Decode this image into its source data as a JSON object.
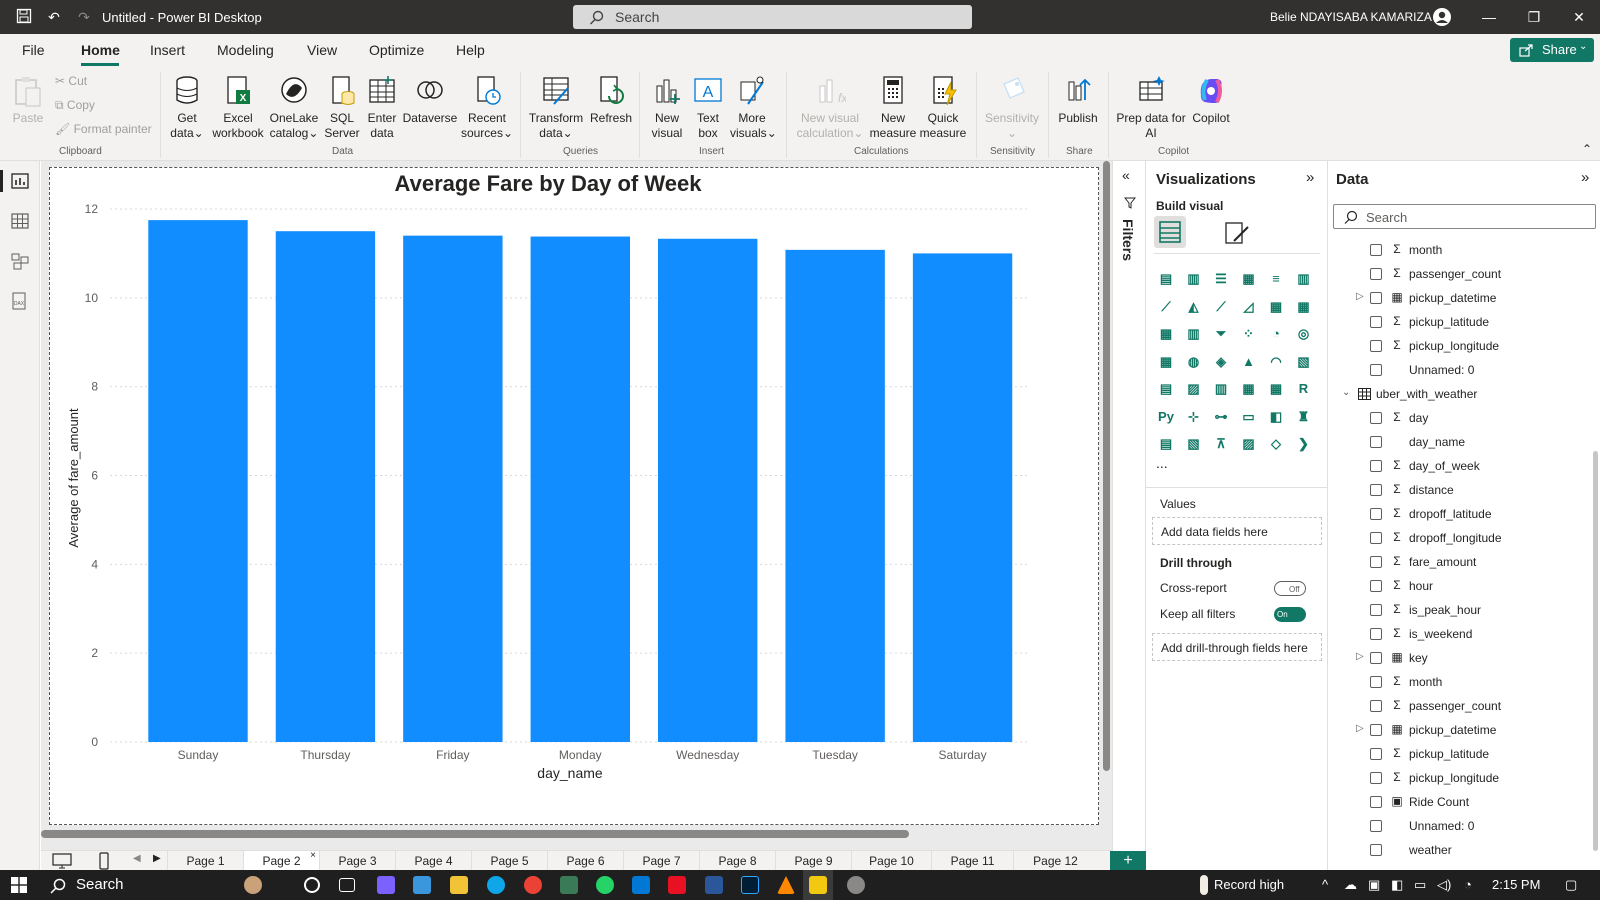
{
  "window": {
    "title": "Untitled - Power BI Desktop",
    "search_placeholder": "Search",
    "user": "Belie NDAYISABA KAMARIZA"
  },
  "menu": [
    "File",
    "Home",
    "Insert",
    "Modeling",
    "View",
    "Optimize",
    "Help"
  ],
  "share_label": "Share",
  "ribbon": {
    "paste": "Paste",
    "cut": "Cut",
    "copy": "Copy",
    "format_painter": "Format painter",
    "get_data_1": "Get",
    "get_data_2": "data",
    "excel_1": "Excel",
    "excel_2": "workbook",
    "onelake_1": "OneLake",
    "onelake_2": "catalog",
    "sql_1": "SQL",
    "sql_2": "Server",
    "enter_1": "Enter",
    "enter_2": "data",
    "dataverse": "Dataverse",
    "recent_1": "Recent",
    "recent_2": "sources",
    "transform_1": "Transform",
    "transform_2": "data",
    "refresh": "Refresh",
    "newvisual_1": "New",
    "newvisual_2": "visual",
    "textbox_1": "Text",
    "textbox_2": "box",
    "morevisuals_1": "More",
    "morevisuals_2": "visuals",
    "newvc_1": "New visual",
    "newvc_2": "calculation",
    "newmeasure_1": "New",
    "newmeasure_2": "measure",
    "quick_1": "Quick",
    "quick_2": "measure",
    "sensitivity": "Sensitivity",
    "publish": "Publish",
    "prep_1": "Prep data for",
    "prep_2": "AI",
    "copilot": "Copilot",
    "groups": {
      "clipboard": "Clipboard",
      "data": "Data",
      "queries": "Queries",
      "insert": "Insert",
      "calculations": "Calculations",
      "sensitivity": "Sensitivity",
      "share": "Share",
      "copilot": "Copilot"
    }
  },
  "chart_data": {
    "type": "bar",
    "title": "Average Fare by Day of Week",
    "xlabel": "day_name",
    "ylabel": "Average of fare_amount",
    "categories": [
      "Sunday",
      "Thursday",
      "Friday",
      "Monday",
      "Wednesday",
      "Tuesday",
      "Saturday"
    ],
    "values": [
      11.75,
      11.5,
      11.4,
      11.38,
      11.33,
      11.08,
      11.0
    ],
    "ylim": [
      0,
      12
    ],
    "yticks": [
      "0",
      "2",
      "4",
      "6",
      "8",
      "10",
      "12"
    ],
    "grid": true,
    "bar_color": "#118DFF"
  },
  "filters_label": "Filters",
  "viz": {
    "title": "Visualizations",
    "build_visual": "Build visual",
    "more": "...",
    "values_label": "Values",
    "values_drop": "Add data fields here",
    "drill_label": "Drill through",
    "cross_report": "Cross-report",
    "cross_state": "Off",
    "keep_filters": "Keep all filters",
    "keep_state": "On",
    "drill_drop": "Add drill-through fields here"
  },
  "data_pane": {
    "title": "Data",
    "search_placeholder": "Search",
    "table_name": "uber_with_weather",
    "fields_top": [
      {
        "name": "month",
        "type": "Σ"
      },
      {
        "name": "passenger_count",
        "type": "Σ"
      },
      {
        "name": "pickup_datetime",
        "type": "▦",
        "expand": true
      },
      {
        "name": "pickup_latitude",
        "type": "Σ"
      },
      {
        "name": "pickup_longitude",
        "type": "Σ"
      },
      {
        "name": "Unnamed: 0",
        "type": ""
      }
    ],
    "fields": [
      {
        "name": "day",
        "type": "Σ"
      },
      {
        "name": "day_name",
        "type": ""
      },
      {
        "name": "day_of_week",
        "type": "Σ"
      },
      {
        "name": "distance",
        "type": "Σ"
      },
      {
        "name": "dropoff_latitude",
        "type": "Σ"
      },
      {
        "name": "dropoff_longitude",
        "type": "Σ"
      },
      {
        "name": "fare_amount",
        "type": "Σ"
      },
      {
        "name": "hour",
        "type": "Σ"
      },
      {
        "name": "is_peak_hour",
        "type": "Σ"
      },
      {
        "name": "is_weekend",
        "type": "Σ"
      },
      {
        "name": "key",
        "type": "▦",
        "expand": true
      },
      {
        "name": "month",
        "type": "Σ"
      },
      {
        "name": "passenger_count",
        "type": "Σ"
      },
      {
        "name": "pickup_datetime",
        "type": "▦",
        "expand": true
      },
      {
        "name": "pickup_latitude",
        "type": "Σ"
      },
      {
        "name": "pickup_longitude",
        "type": "Σ"
      },
      {
        "name": "Ride Count",
        "type": "▣"
      },
      {
        "name": "Unnamed: 0",
        "type": ""
      },
      {
        "name": "weather",
        "type": ""
      }
    ]
  },
  "pages": [
    "Page 1",
    "Page 2",
    "Page 3",
    "Page 4",
    "Page 5",
    "Page 6",
    "Page 7",
    "Page 8",
    "Page 9",
    "Page 10",
    "Page 11",
    "Page 12"
  ],
  "active_page": "Page 2",
  "taskbar": {
    "search": "Search",
    "weather": "Record high",
    "time": "2:15 PM"
  },
  "colors": {
    "accent": "#117865",
    "bar": "#118DFF",
    "titlebar": "#323130"
  }
}
